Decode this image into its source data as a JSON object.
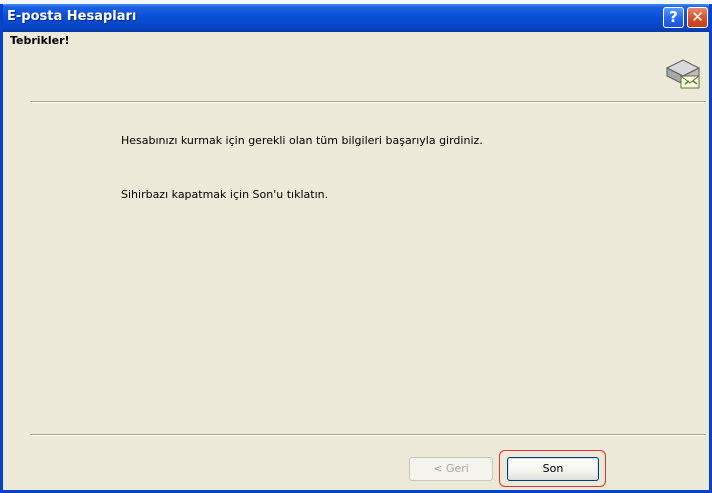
{
  "window": {
    "title": "E-posta Hesapları",
    "help_glyph": "?",
    "close_glyph": "✕"
  },
  "header": {
    "title": "Tebrikler!",
    "icon": "mail-envelope-icon"
  },
  "body": {
    "line1": "Hesabınızı kurmak için gerekli olan tüm bilgileri başarıyla girdiniz.",
    "line2": "Sihirbazı kapatmak için Son'u tıklatın."
  },
  "buttons": {
    "back_label": "< Geri",
    "finish_label": "Son"
  },
  "colors": {
    "titlebar": "#0a4fd8",
    "dialog_bg": "#ece9d8",
    "highlight": "#e03030"
  }
}
